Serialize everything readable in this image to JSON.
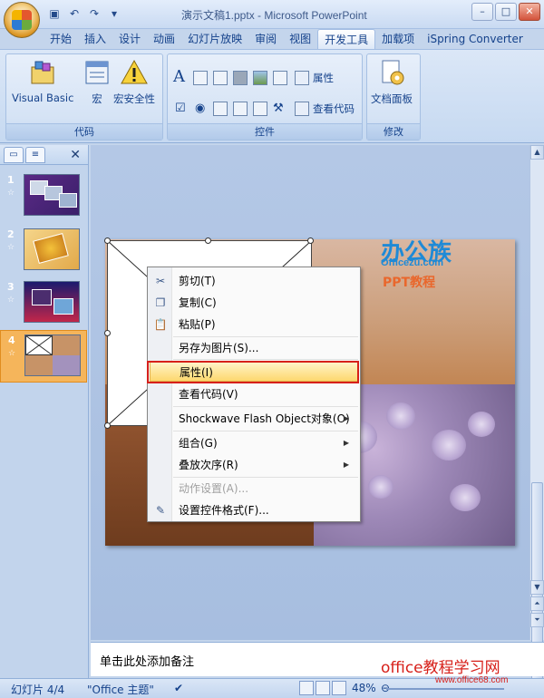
{
  "window": {
    "title": "演示文稿1.pptx - Microsoft PowerPoint"
  },
  "quick_access": [
    "save-icon",
    "undo-icon",
    "redo-icon",
    "customize-qat-icon"
  ],
  "tabs": [
    {
      "label": "开始"
    },
    {
      "label": "插入"
    },
    {
      "label": "设计"
    },
    {
      "label": "动画"
    },
    {
      "label": "幻灯片放映"
    },
    {
      "label": "审阅"
    },
    {
      "label": "视图"
    },
    {
      "label": "开发工具",
      "active": true
    },
    {
      "label": "加载项"
    },
    {
      "label": "iSpring Converter"
    }
  ],
  "ribbon": {
    "code_group": {
      "label": "代码",
      "buttons": [
        {
          "label": "Visual Basic"
        },
        {
          "label": "宏"
        },
        {
          "label": "宏安全性"
        }
      ]
    },
    "controls_group": {
      "label": "控件",
      "properties_label": "属性",
      "view_code_label": "查看代码"
    },
    "modify_group": {
      "label": "修改",
      "doc_panel_label": "文档面板"
    }
  },
  "slides_pane": {
    "slides": [
      {
        "number": "1"
      },
      {
        "number": "2"
      },
      {
        "number": "3"
      },
      {
        "number": "4",
        "selected": true
      }
    ]
  },
  "slide": {
    "brand_zh": "办公族",
    "brand_en": "Officezu.com",
    "brand_sub": "PPT教程"
  },
  "context_menu": {
    "items": [
      {
        "label": "剪切(T)",
        "icon": "scissors-icon"
      },
      {
        "label": "复制(C)",
        "icon": "copy-icon"
      },
      {
        "label": "粘贴(P)",
        "icon": "paste-icon"
      },
      {
        "label": "另存为图片(S)..."
      },
      {
        "label": "属性(I)",
        "highlighted": true
      },
      {
        "label": "查看代码(V)"
      },
      {
        "label": "Shockwave Flash Object对象(O)",
        "submenu": true
      },
      {
        "label": "组合(G)",
        "submenu": true
      },
      {
        "label": "叠放次序(R)",
        "submenu": true
      },
      {
        "label": "动作设置(A)...",
        "disabled": true
      },
      {
        "label": "设置控件格式(F)...",
        "icon": "format-control-icon"
      }
    ]
  },
  "notes": {
    "placeholder": "单击此处添加备注"
  },
  "watermark": {
    "line1": "office教程学习网",
    "line2": "www.office68.com"
  },
  "status_bar": {
    "slide_indicator": "幻灯片 4/4",
    "theme": "\"Office 主题\"",
    "zoom": "48%"
  }
}
